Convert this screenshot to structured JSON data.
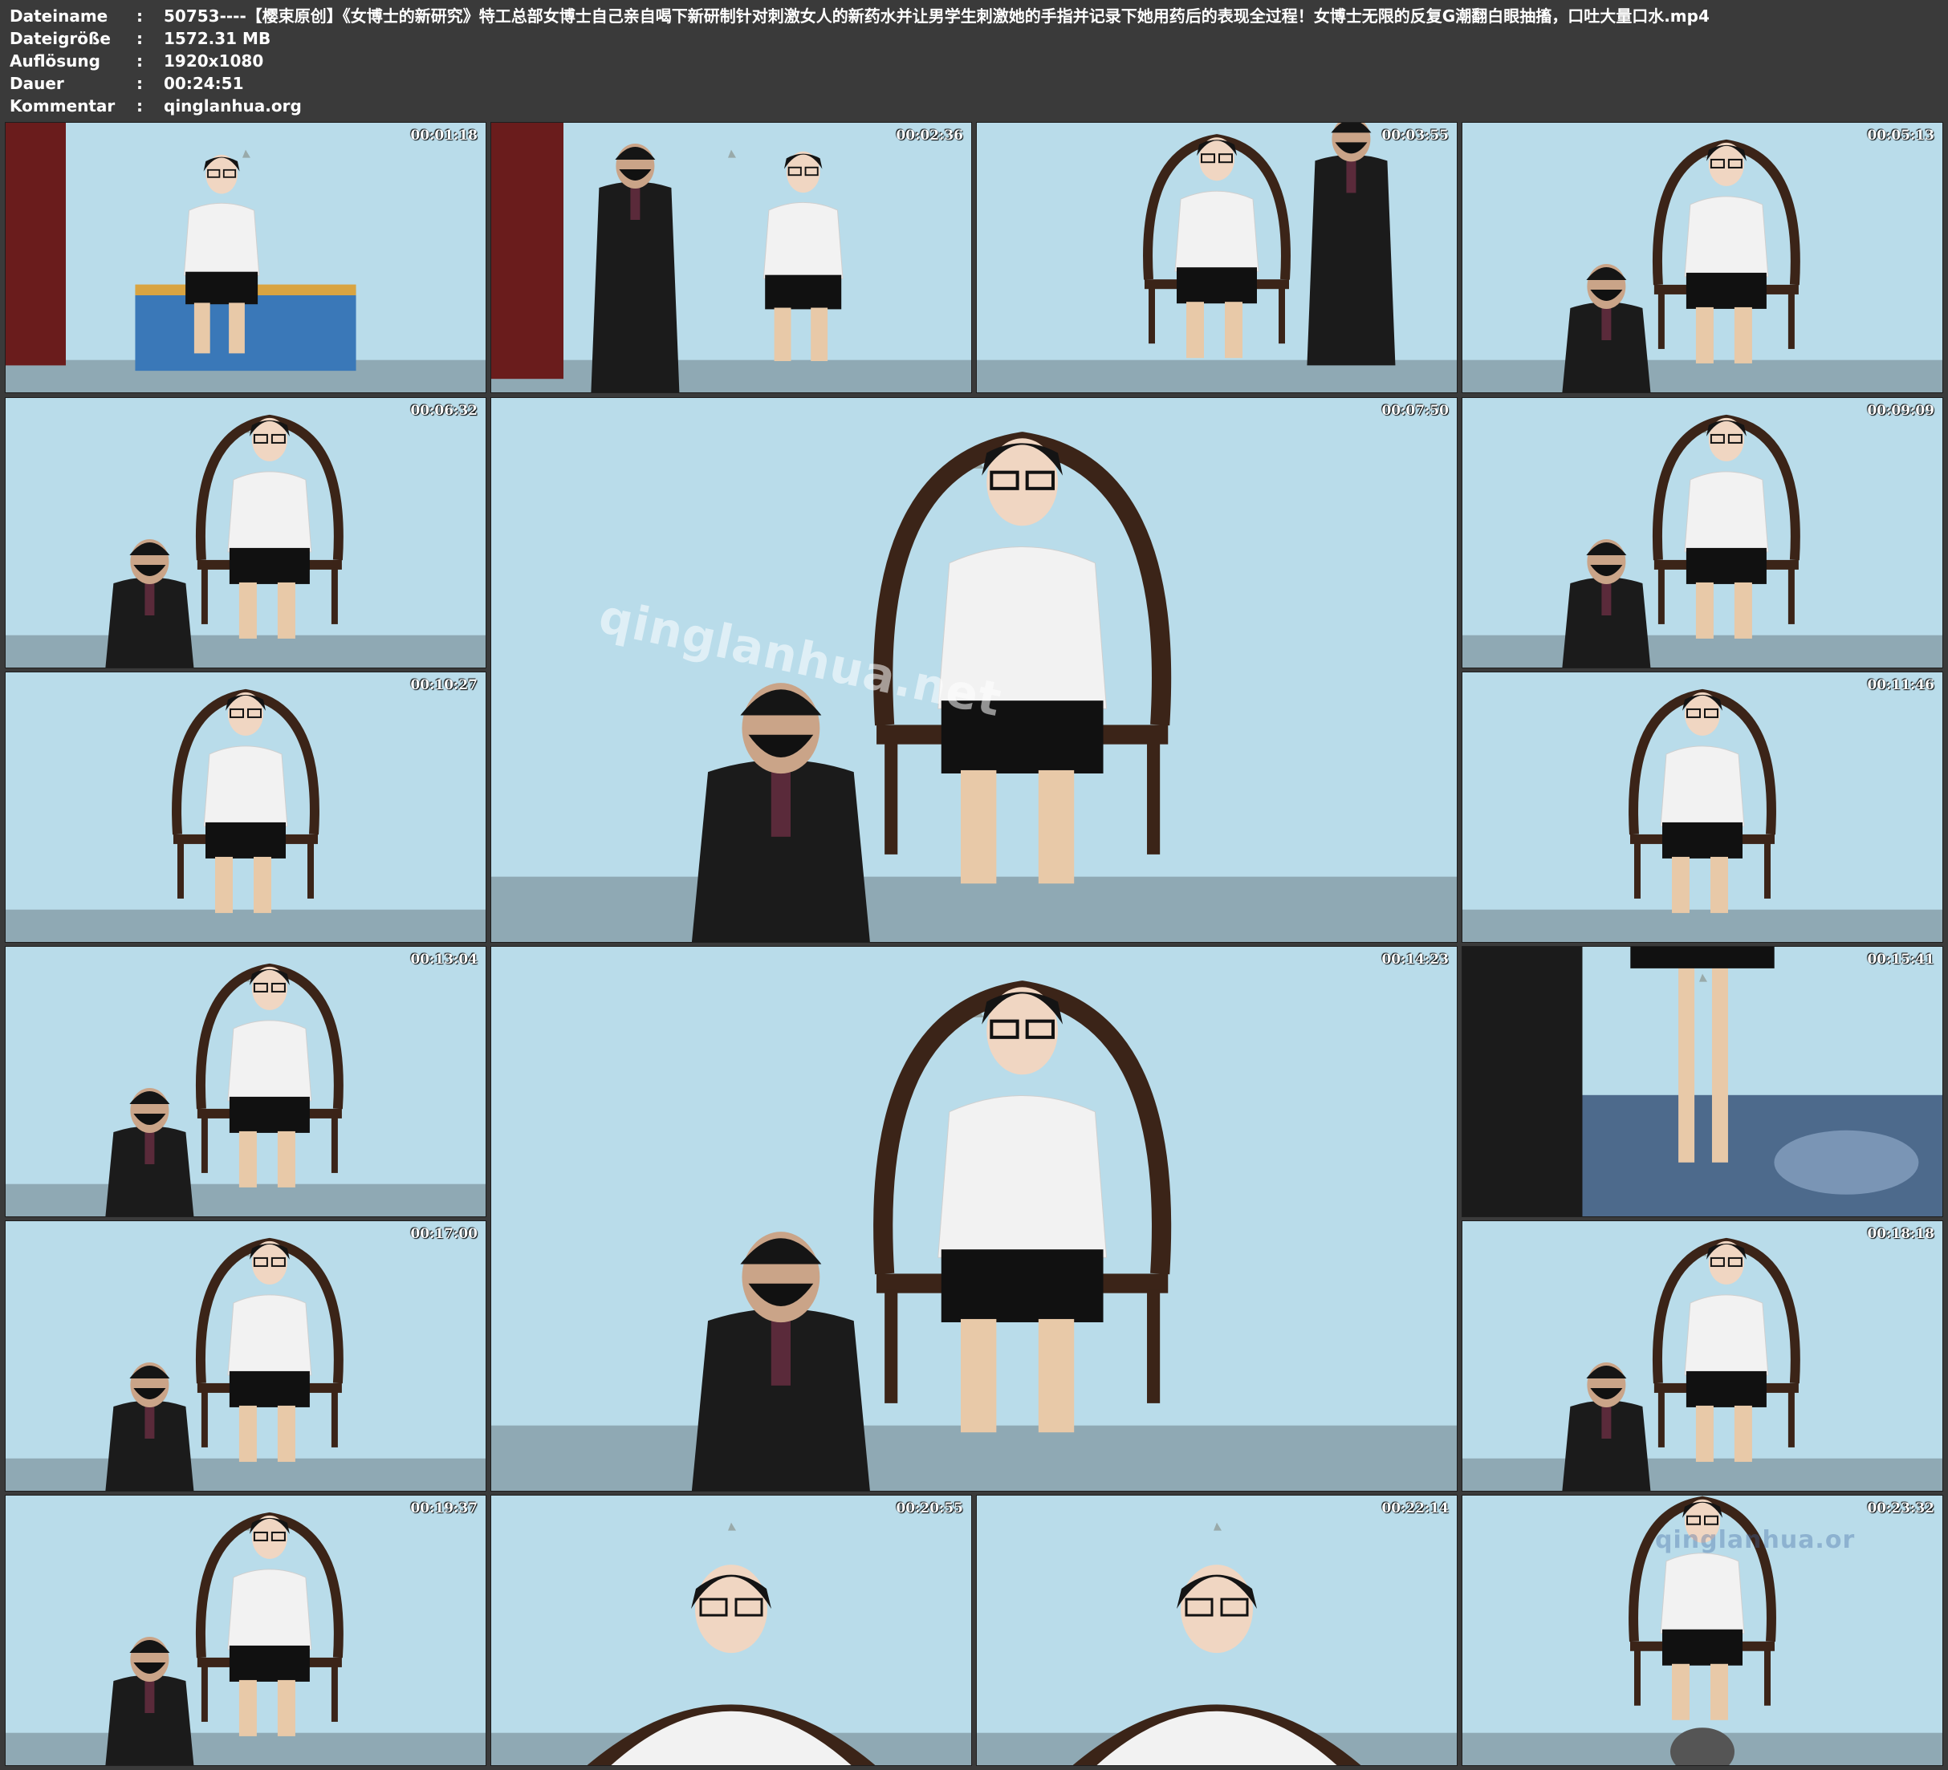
{
  "info": [
    {
      "key": "Dateiname",
      "sep": ":",
      "value": "50753----【樱束原创】《女博士的新研究》特工总部女博士自己亲自喝下新研制针对刺激女人的新药水并让男学生刺激她的手指并记录下她用药后的表现全过程！女博士无限的反复G潮翻白眼抽搐，口吐大量口水.mp4"
    },
    {
      "key": "Dateigröße",
      "sep": ":",
      "value": "1572.31 MB"
    },
    {
      "key": "Auflösung",
      "sep": ":",
      "value": "1920x1080"
    },
    {
      "key": "Dauer",
      "sep": ":",
      "value": "00:24:51"
    },
    {
      "key": "Kommentar",
      "sep": ":",
      "value": "qinglanhua.org"
    }
  ],
  "thumbnails": [
    {
      "timestamp": "00:01:18",
      "scene": "door-desk"
    },
    {
      "timestamp": "00:02:36",
      "scene": "door-standing"
    },
    {
      "timestamp": "00:03:55",
      "scene": "chair-standing-man"
    },
    {
      "timestamp": "00:05:13",
      "scene": "chair-kneeling"
    },
    {
      "timestamp": "00:06:32",
      "scene": "chair-kneeling"
    },
    {
      "timestamp": "00:07:50",
      "scene": "chair-kneeling-large"
    },
    {
      "timestamp": "00:09:09",
      "scene": "chair-kneeling"
    },
    {
      "timestamp": "00:10:27",
      "scene": "chair-alone"
    },
    {
      "timestamp": "00:11:46",
      "scene": "chair-alone"
    },
    {
      "timestamp": "00:13:04",
      "scene": "chair-kneeling"
    },
    {
      "timestamp": "00:14:23",
      "scene": "chair-kneeling-large"
    },
    {
      "timestamp": "00:15:41",
      "scene": "legs-rug"
    },
    {
      "timestamp": "00:17:00",
      "scene": "chair-kneeling"
    },
    {
      "timestamp": "00:18:18",
      "scene": "chair-kneeling"
    },
    {
      "timestamp": "00:19:37",
      "scene": "chair-kneeling"
    },
    {
      "timestamp": "00:20:55",
      "scene": "closeup"
    },
    {
      "timestamp": "00:22:14",
      "scene": "closeup"
    },
    {
      "timestamp": "00:23:32",
      "scene": "chair-phone"
    }
  ],
  "watermarks": {
    "large_center": "qinglanhua.net",
    "corner": "qinglanhua.or"
  },
  "colors": {
    "background": "#3a3a3a",
    "wall": "#b9dcea",
    "shirt": "#f2f2f2",
    "skirt": "#111111",
    "suit": "#1b1b1b",
    "chair": "#3b2418",
    "door": "#6a1c1c"
  }
}
